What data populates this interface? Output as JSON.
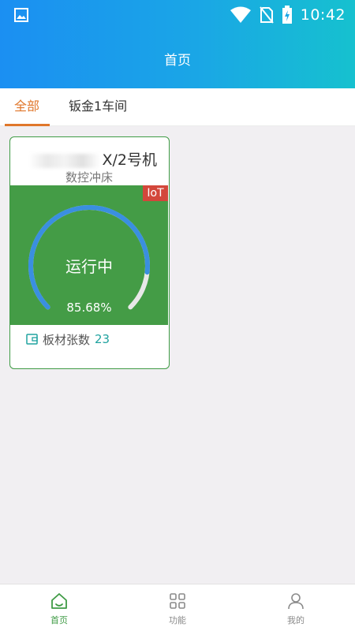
{
  "status_bar": {
    "time": "10:42",
    "icons": [
      "image-icon",
      "wifi-icon",
      "no-sim-icon",
      "battery-charging-icon"
    ]
  },
  "header": {
    "title": "首页"
  },
  "tabs": [
    {
      "label": "全部",
      "active": true
    },
    {
      "label": "钣金1车间",
      "active": false
    }
  ],
  "machine_card": {
    "title_suffix": "X/2号机",
    "subtitle": "数控冲床",
    "badge": "IoT",
    "status": "运行中",
    "utilization_label": "85.68%",
    "utilization_fraction": 0.8568,
    "sheet_count_label": "板材张数",
    "sheet_count_value": "23",
    "colors": {
      "panel": "#449c46",
      "arc": "#3a8fe0",
      "arc_track": "#e8e8e8",
      "badge": "#d3473b",
      "border": "#3f9b45"
    }
  },
  "bottom_nav": [
    {
      "label": "首页",
      "icon": "home-icon",
      "active": true
    },
    {
      "label": "功能",
      "icon": "grid-icon",
      "active": false
    },
    {
      "label": "我的",
      "icon": "user-icon",
      "active": false
    }
  ],
  "colors": {
    "accent_tab": "#e0772b",
    "nav_active": "#3f9b45",
    "header_gradient_start": "#1b8ff2",
    "header_gradient_end": "#16c1cf"
  }
}
